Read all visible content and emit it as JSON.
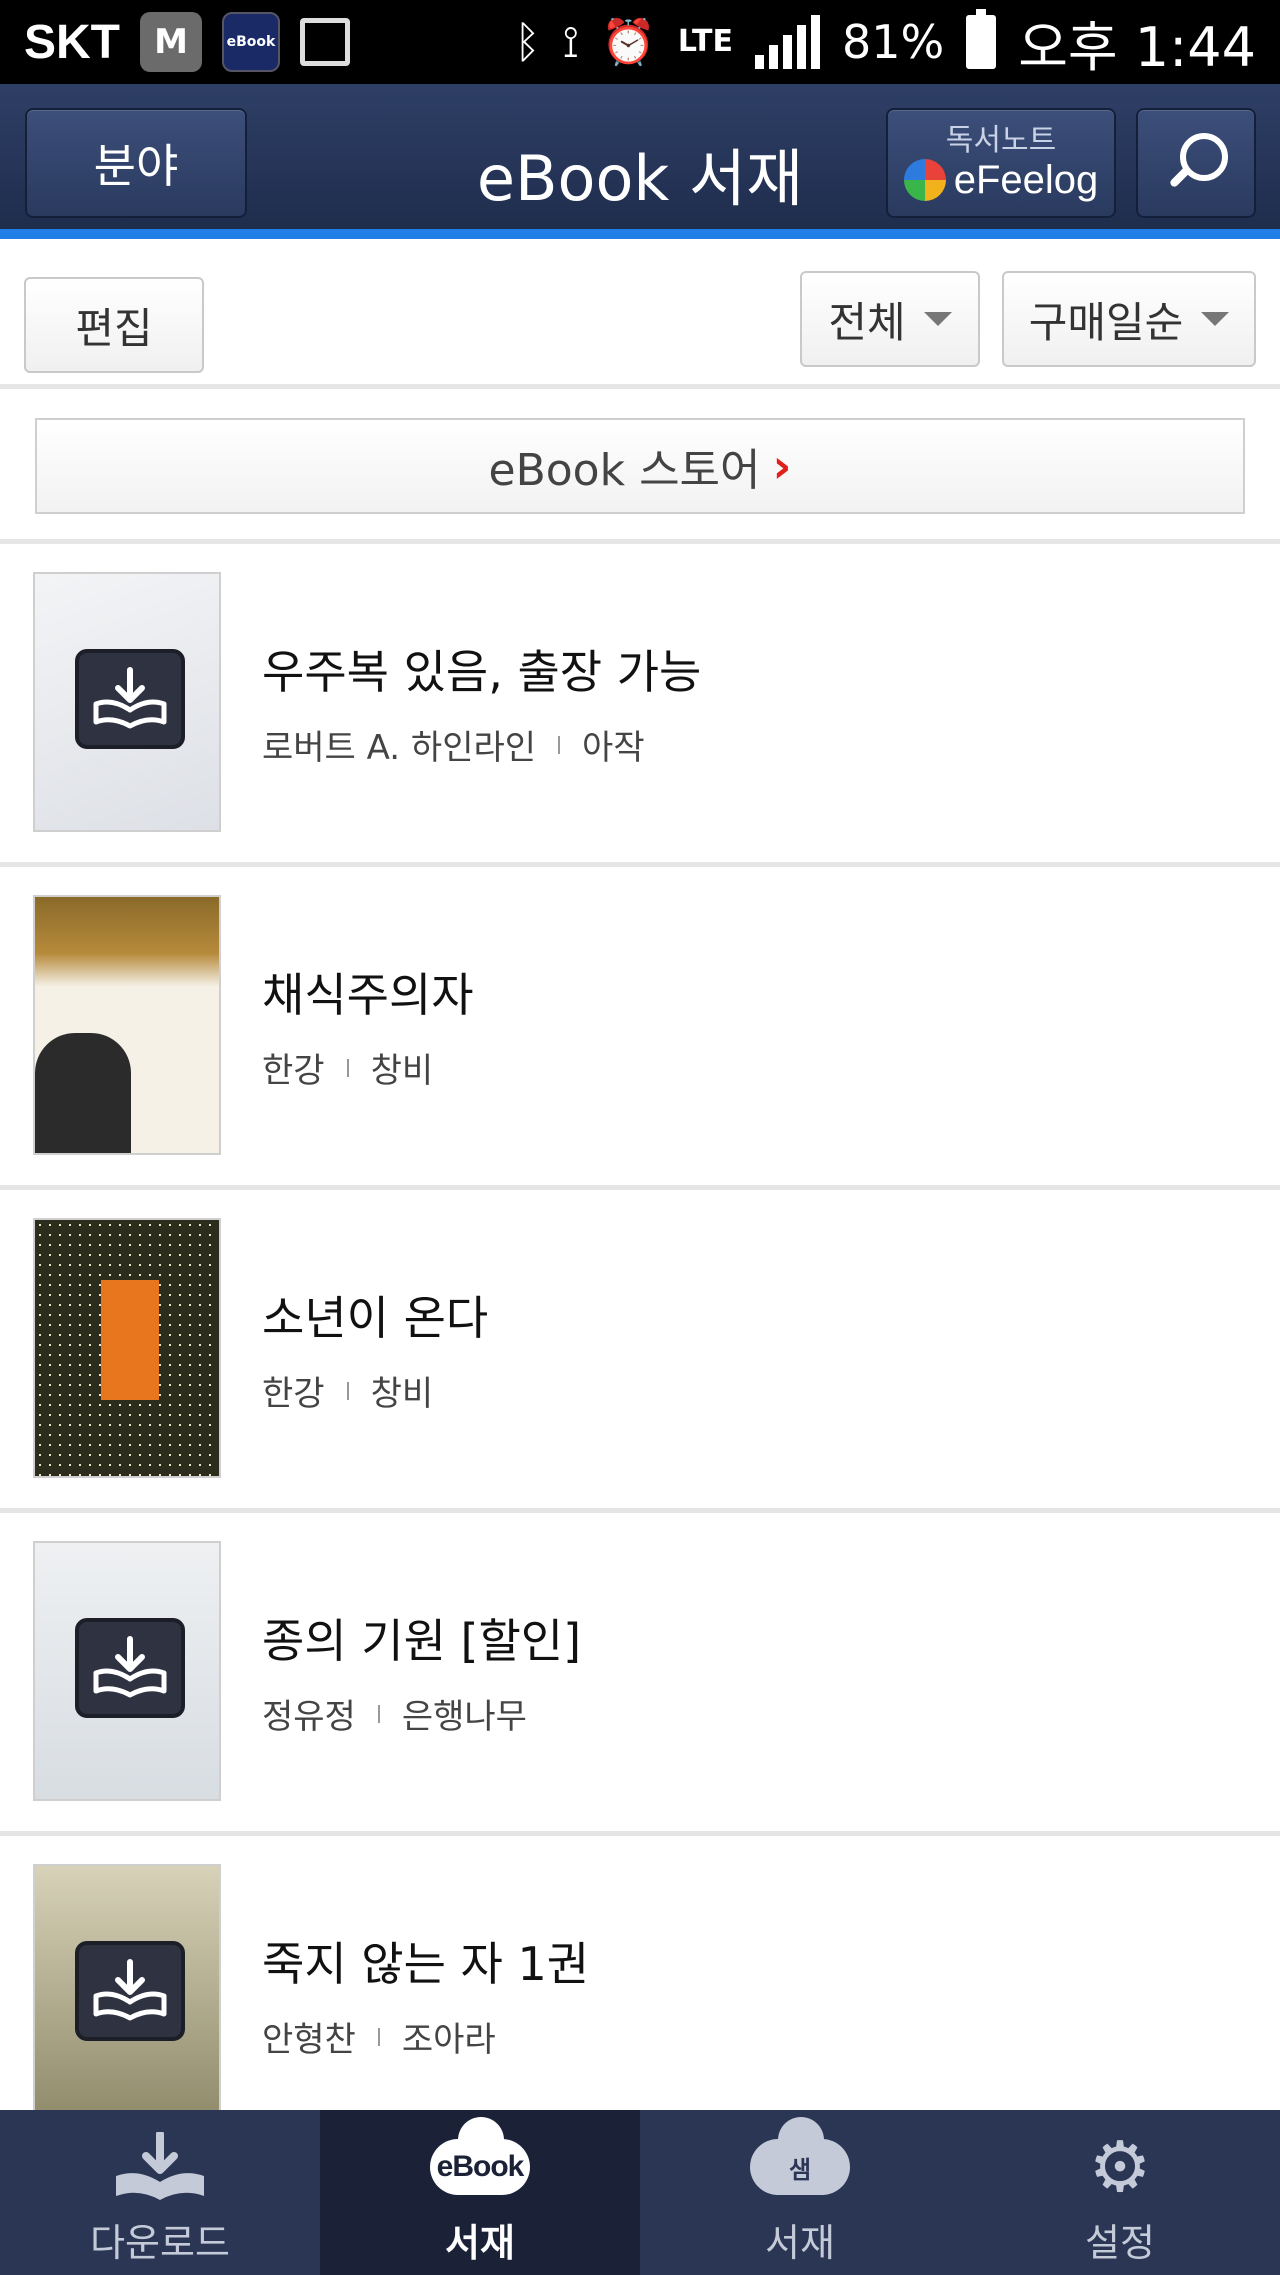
{
  "status_bar": {
    "carrier": "SKT",
    "app_icon_m": "M",
    "app_icon_ebook": "eBook",
    "battery": "81%",
    "time": "오후 1:44",
    "network": "LTE"
  },
  "header": {
    "category_label": "분야",
    "title": "eBook 서재",
    "efeelog_caption": "독서노트",
    "efeelog_name": "eFeelog"
  },
  "toolbar": {
    "edit_label": "편집",
    "filter_label": "전체",
    "sort_label": "구매일순"
  },
  "store_banner": {
    "label": "eBook 스토어",
    "chevron": "›"
  },
  "books": [
    {
      "title": "우주복 있음, 출장 가능",
      "author": "로버트 A. 하인라인",
      "publisher": "아작",
      "downloaded": false
    },
    {
      "title": "채식주의자",
      "author": "한강",
      "publisher": "창비",
      "downloaded": true
    },
    {
      "title": "소년이 온다",
      "author": "한강",
      "publisher": "창비",
      "downloaded": true
    },
    {
      "title": "종의 기원 [할인]",
      "author": "정유정",
      "publisher": "은행나무",
      "downloaded": false
    },
    {
      "title": "죽지 않는 자 1권",
      "author": "안형찬",
      "publisher": "조아라",
      "downloaded": false
    }
  ],
  "bottom_nav": [
    {
      "label": "다운로드",
      "icon": "download-tray-icon",
      "active": false
    },
    {
      "label": "서재",
      "icon": "ebook-cloud-icon",
      "icon_text": "eBook",
      "active": true
    },
    {
      "label": "서재",
      "icon": "sam-cloud-icon",
      "icon_text": "샘",
      "active": false
    },
    {
      "label": "설정",
      "icon": "gear-icon",
      "active": false
    }
  ],
  "colors": {
    "header_bg": "#2e3f66",
    "accent_line": "#1f7fe6",
    "nav_bg": "#2b3655",
    "nav_active_bg": "#1b2238",
    "store_chevron": "#e0201c"
  }
}
